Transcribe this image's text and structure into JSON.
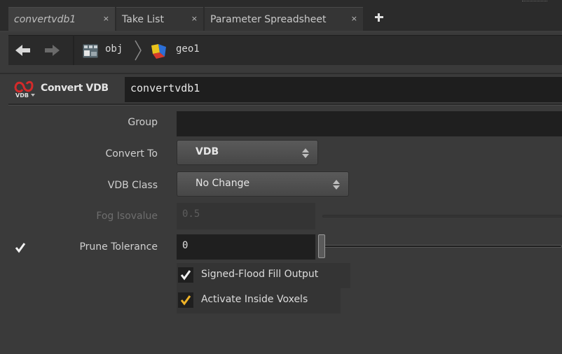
{
  "tabs": [
    {
      "label": "convertvdb1",
      "close": "×"
    },
    {
      "label": "Take List",
      "close": "×"
    },
    {
      "label": "Parameter Spreadsheet",
      "close": "×"
    }
  ],
  "path": {
    "crumbs": [
      "obj",
      "geo1"
    ]
  },
  "node": {
    "type_label": "Convert VDB",
    "name": "convertvdb1"
  },
  "params": {
    "group": {
      "label": "Group",
      "value": ""
    },
    "convert_to": {
      "label": "Convert To",
      "value": "VDB"
    },
    "vdb_class": {
      "label": "VDB Class",
      "value": "No Change"
    },
    "fog_isovalue": {
      "label": "Fog Isovalue",
      "value": "0.5",
      "enabled": false
    },
    "prune_tolerance": {
      "label": "Prune Tolerance",
      "value": "0",
      "enabled": true
    },
    "signed_flood_fill": {
      "label": "Signed-Flood Fill Output",
      "checked": true
    },
    "activate_inside": {
      "label": "Activate Inside Voxels",
      "checked": true
    }
  },
  "colors": {
    "accent_check": "#f0b428",
    "check_white": "#f2f2f2",
    "node_icon_red": "#d42a2a"
  },
  "icons": {
    "back": "arrow-left-icon",
    "forward": "arrow-right-icon",
    "obj": "obj-network-icon",
    "geo": "geo-node-icon",
    "node": "vdb-node-icon"
  }
}
